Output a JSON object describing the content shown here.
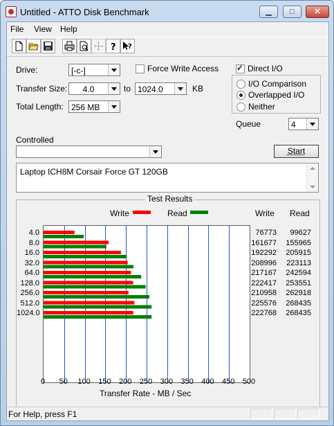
{
  "window": {
    "title": "Untitled - ATTO Disk Benchmark"
  },
  "menu": [
    "File",
    "View",
    "Help"
  ],
  "toolbar": {
    "icons": [
      "new-file-icon",
      "open-folder-icon",
      "save-icon",
      "print-icon",
      "print-preview-icon",
      "move-icon",
      "help-icon",
      "context-help-icon"
    ]
  },
  "settings": {
    "drive_label": "Drive:",
    "drive_value": "[-c-]",
    "force_write_label": "Force Write Access",
    "force_write_checked": false,
    "direct_io_label": "Direct I/O",
    "direct_io_checked": true,
    "transfer_size_label": "Transfer Size:",
    "transfer_from": "4.0",
    "to_label": "to",
    "transfer_to": "1024.0",
    "kb_label": "KB",
    "total_length_label": "Total Length:",
    "total_length_value": "256 MB",
    "io_modes": [
      {
        "label": "I/O Comparison",
        "selected": false
      },
      {
        "label": "Overlapped I/O",
        "selected": true
      },
      {
        "label": "Neither",
        "selected": false
      }
    ],
    "queue_label": "Queue",
    "queue_value": "4",
    "controlled_label": "Controlled",
    "controlled_value": "",
    "start_label": "Start",
    "description": "Laptop ICH8M Corsair Force GT 120GB"
  },
  "colors": {
    "write": "#ff0000",
    "read": "#008000"
  },
  "results": {
    "title": "Test Results",
    "write_legend": "Write",
    "read_legend": "Read",
    "write_col": "Write",
    "read_col": "Read"
  },
  "chart_data": {
    "type": "bar",
    "orientation": "horizontal",
    "categories": [
      "4.0",
      "8.0",
      "16.0",
      "32.0",
      "64.0",
      "128.0",
      "256.0",
      "512.0",
      "1024.0"
    ],
    "series": [
      {
        "name": "Write",
        "values": [
          76773,
          161677,
          192292,
          208996,
          217167,
          222417,
          210958,
          225576,
          222768
        ]
      },
      {
        "name": "Read",
        "values": [
          99627,
          155965,
          205915,
          223113,
          242594,
          253551,
          262918,
          268435,
          268435
        ]
      }
    ],
    "write_display": [
      "76773",
      "161677",
      "192292",
      "208996",
      "217167",
      "222417",
      "210958",
      "225576",
      "222768"
    ],
    "read_display": [
      "99627",
      "155965",
      "205915",
      "223113",
      "242594",
      "253551",
      "262918",
      "268435",
      "268435"
    ],
    "x_ticks": [
      "0",
      "50",
      "100",
      "150",
      "200",
      "250",
      "300",
      "350",
      "400",
      "450",
      "500"
    ],
    "xlim": [
      0,
      500
    ],
    "xlabel": "Transfer Rate - MB / Sec",
    "grid": true,
    "legend": "top"
  },
  "status": {
    "text": "For Help, press F1"
  }
}
